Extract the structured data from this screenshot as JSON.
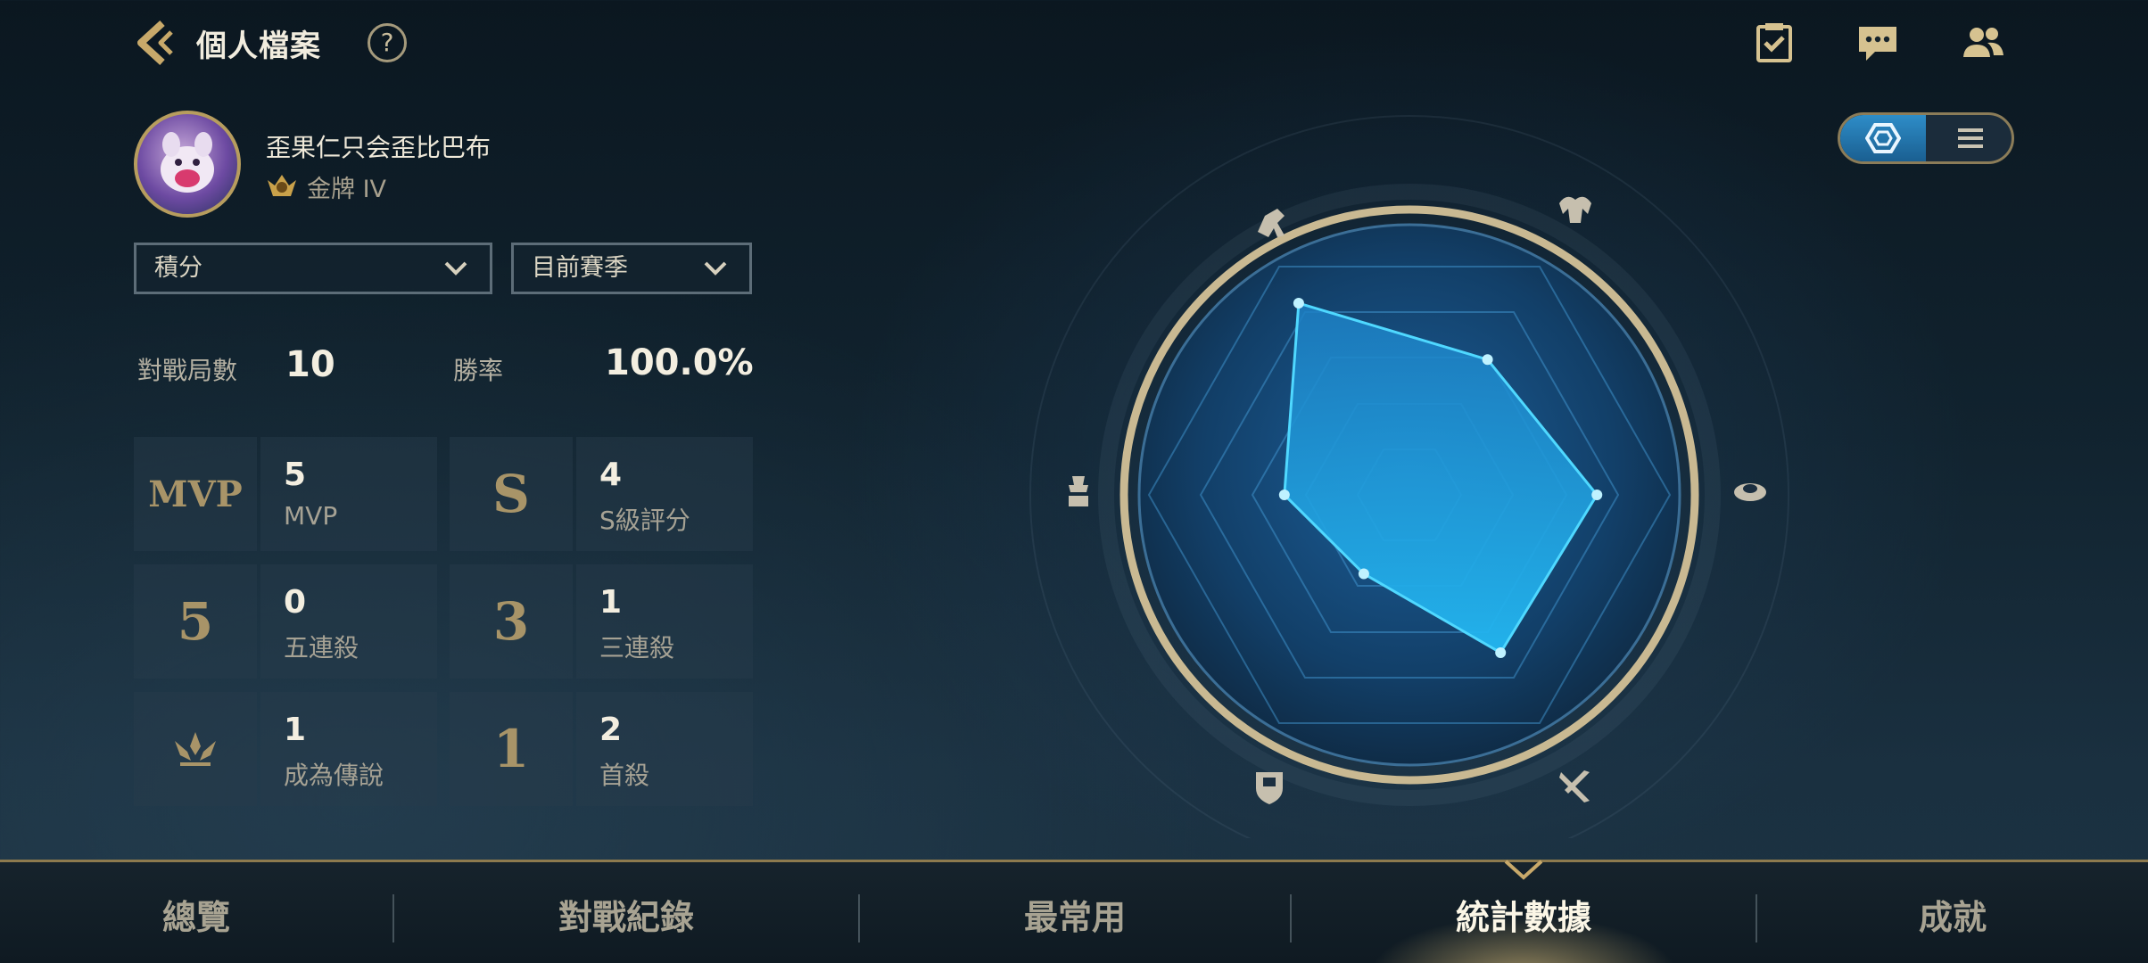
{
  "header": {
    "title": "個人檔案",
    "help_label": "?",
    "icons": [
      "back-icon",
      "help-icon",
      "task-icon",
      "chat-icon",
      "friends-icon"
    ]
  },
  "profile": {
    "name": "歪果仁只会歪比巴布",
    "rank": "金牌 IV"
  },
  "filters": {
    "mode": "積分",
    "season": "目前賽季"
  },
  "summary": {
    "matches_label": "對戰局數",
    "matches_value": "10",
    "winrate_label": "勝率",
    "winrate_value": "100.0%"
  },
  "stats": [
    {
      "icon_text": "MVP",
      "value": "5",
      "label": "MVP"
    },
    {
      "icon_text": "S",
      "value": "4",
      "label": "S級評分"
    },
    {
      "icon_text": "5",
      "value": "0",
      "label": "五連殺"
    },
    {
      "icon_text": "3",
      "value": "1",
      "label": "三連殺"
    },
    {
      "icon_text": "",
      "value": "1",
      "label": "成為傳說"
    },
    {
      "icon_text": "1",
      "value": "2",
      "label": "首殺"
    }
  ],
  "view_toggle": {
    "options": [
      "radar-icon",
      "list-icon"
    ],
    "selected": "radar-icon"
  },
  "radar": {
    "axes": [
      "fighter-icon",
      "mage-icon",
      "support-icon",
      "assassin-icon",
      "tank-icon",
      "jungle-icon"
    ],
    "values": [
      0.85,
      0.6,
      0.72,
      0.48,
      0.35,
      0.7
    ]
  },
  "colors": {
    "accent_gold": "#c8a96a",
    "radar_fill": "#1fa8ea",
    "radar_line": "#4fd8ff"
  },
  "nav": {
    "tabs": [
      "總覽",
      "對戰紀錄",
      "最常用",
      "統計數據",
      "成就"
    ],
    "active_index": 3
  }
}
